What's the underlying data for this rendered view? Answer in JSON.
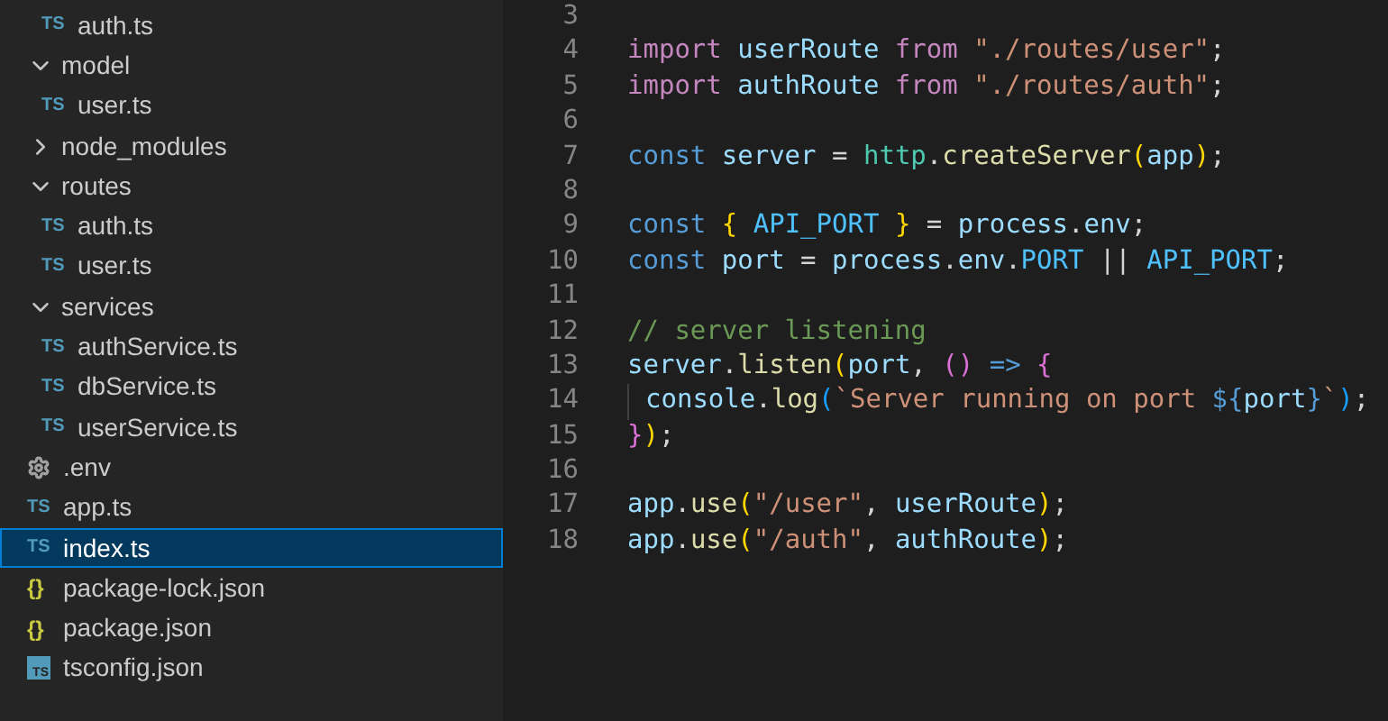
{
  "sidebar": {
    "items": [
      {
        "children": [
          {
            "label": "auth.ts",
            "kind": "ts",
            "badge": "TS",
            "selected": false
          }
        ]
      },
      {
        "label": "model",
        "kind": "folder",
        "expanded": true,
        "selected": false,
        "children": [
          {
            "label": "user.ts",
            "kind": "ts",
            "badge": "TS",
            "selected": false
          }
        ]
      },
      {
        "label": "node_modules",
        "kind": "folder",
        "expanded": false,
        "selected": false
      },
      {
        "label": "routes",
        "kind": "folder",
        "expanded": true,
        "selected": false,
        "children": [
          {
            "label": "auth.ts",
            "kind": "ts",
            "badge": "TS",
            "selected": false
          },
          {
            "label": "user.ts",
            "kind": "ts",
            "badge": "TS",
            "selected": false
          }
        ]
      },
      {
        "label": "services",
        "kind": "folder",
        "expanded": true,
        "selected": false,
        "children": [
          {
            "label": "authService.ts",
            "kind": "ts",
            "badge": "TS",
            "selected": false
          },
          {
            "label": "dbService.ts",
            "kind": "ts",
            "badge": "TS",
            "selected": false
          },
          {
            "label": "userService.ts",
            "kind": "ts",
            "badge": "TS",
            "selected": false
          }
        ]
      },
      {
        "label": ".env",
        "kind": "env",
        "selected": false
      },
      {
        "label": "app.ts",
        "kind": "ts",
        "badge": "TS",
        "selected": false
      },
      {
        "label": "index.ts",
        "kind": "ts",
        "badge": "TS",
        "selected": true
      },
      {
        "label": "package-lock.json",
        "kind": "json",
        "badge": "{}",
        "selected": false
      },
      {
        "label": "package.json",
        "kind": "json",
        "badge": "{}",
        "selected": false
      },
      {
        "label": "tsconfig.json",
        "kind": "tsconfig",
        "badge": "TS",
        "selected": false
      }
    ]
  },
  "editor": {
    "lines": [
      {
        "number": "3"
      },
      {
        "number": "4",
        "tokens": [
          {
            "text": "import ",
            "color": "#c586c0"
          },
          {
            "text": "userRoute ",
            "color": "#9cdcfe"
          },
          {
            "text": "from ",
            "color": "#c586c0"
          },
          {
            "text": "\"./routes/user\"",
            "color": "#ce9178"
          },
          {
            "text": ";",
            "color": "#d4d4d4"
          }
        ]
      },
      {
        "number": "5",
        "tokens": [
          {
            "text": "import ",
            "color": "#c586c0"
          },
          {
            "text": "authRoute ",
            "color": "#9cdcfe"
          },
          {
            "text": "from ",
            "color": "#c586c0"
          },
          {
            "text": "\"./routes/auth\"",
            "color": "#ce9178"
          },
          {
            "text": ";",
            "color": "#d4d4d4"
          }
        ]
      },
      {
        "number": "6"
      },
      {
        "number": "7",
        "tokens": [
          {
            "text": "const ",
            "color": "#569cd6"
          },
          {
            "text": "server",
            "color": "#9cdcfe"
          },
          {
            "text": " = ",
            "color": "#d4d4d4"
          },
          {
            "text": "http",
            "color": "#4ec9b0"
          },
          {
            "text": ".",
            "color": "#d4d4d4"
          },
          {
            "text": "createServer",
            "color": "#dcdcaa"
          },
          {
            "text": "(",
            "color": "#ffd700"
          },
          {
            "text": "app",
            "color": "#9cdcfe"
          },
          {
            "text": ")",
            "color": "#ffd700"
          },
          {
            "text": ";",
            "color": "#d4d4d4"
          }
        ]
      },
      {
        "number": "8"
      },
      {
        "number": "9",
        "tokens": [
          {
            "text": "const ",
            "color": "#569cd6"
          },
          {
            "text": "{ ",
            "color": "#ffd700"
          },
          {
            "text": "API_PORT ",
            "color": "#4fc1ff"
          },
          {
            "text": "}",
            "color": "#ffd700"
          },
          {
            "text": " = ",
            "color": "#d4d4d4"
          },
          {
            "text": "process",
            "color": "#9cdcfe"
          },
          {
            "text": ".",
            "color": "#d4d4d4"
          },
          {
            "text": "env",
            "color": "#9cdcfe"
          },
          {
            "text": ";",
            "color": "#d4d4d4"
          }
        ]
      },
      {
        "number": "10",
        "tokens": [
          {
            "text": "const ",
            "color": "#569cd6"
          },
          {
            "text": "port",
            "color": "#9cdcfe"
          },
          {
            "text": " = ",
            "color": "#d4d4d4"
          },
          {
            "text": "process",
            "color": "#9cdcfe"
          },
          {
            "text": ".",
            "color": "#d4d4d4"
          },
          {
            "text": "env",
            "color": "#9cdcfe"
          },
          {
            "text": ".",
            "color": "#d4d4d4"
          },
          {
            "text": "PORT",
            "color": "#4fc1ff"
          },
          {
            "text": " || ",
            "color": "#d4d4d4"
          },
          {
            "text": "API_PORT",
            "color": "#4fc1ff"
          },
          {
            "text": ";",
            "color": "#d4d4d4"
          }
        ]
      },
      {
        "number": "11"
      },
      {
        "number": "12",
        "tokens": [
          {
            "text": "// server listening",
            "color": "#6a9955"
          }
        ]
      },
      {
        "number": "13",
        "tokens": [
          {
            "text": "server",
            "color": "#9cdcfe"
          },
          {
            "text": ".",
            "color": "#d4d4d4"
          },
          {
            "text": "listen",
            "color": "#dcdcaa"
          },
          {
            "text": "(",
            "color": "#ffd700"
          },
          {
            "text": "port",
            "color": "#9cdcfe"
          },
          {
            "text": ", ",
            "color": "#d4d4d4"
          },
          {
            "text": "() ",
            "color": "#da70d6"
          },
          {
            "text": "=> ",
            "color": "#569cd6"
          },
          {
            "text": "{",
            "color": "#da70d6"
          }
        ]
      },
      {
        "number": "14",
        "guide": true,
        "tokens": [
          {
            "text": "console",
            "color": "#9cdcfe"
          },
          {
            "text": ".",
            "color": "#d4d4d4"
          },
          {
            "text": "log",
            "color": "#dcdcaa"
          },
          {
            "text": "(",
            "color": "#179fff"
          },
          {
            "text": "`Server running on port ",
            "color": "#ce9178"
          },
          {
            "text": "${",
            "color": "#569cd6"
          },
          {
            "text": "port",
            "color": "#9cdcfe"
          },
          {
            "text": "}",
            "color": "#569cd6"
          },
          {
            "text": "`",
            "color": "#ce9178"
          },
          {
            "text": ")",
            "color": "#179fff"
          },
          {
            "text": ";",
            "color": "#d4d4d4"
          }
        ]
      },
      {
        "number": "15",
        "tokens": [
          {
            "text": "}",
            "color": "#da70d6"
          },
          {
            "text": ")",
            "color": "#ffd700"
          },
          {
            "text": ";",
            "color": "#d4d4d4"
          }
        ]
      },
      {
        "number": "16"
      },
      {
        "number": "17",
        "tokens": [
          {
            "text": "app",
            "color": "#9cdcfe"
          },
          {
            "text": ".",
            "color": "#d4d4d4"
          },
          {
            "text": "use",
            "color": "#dcdcaa"
          },
          {
            "text": "(",
            "color": "#ffd700"
          },
          {
            "text": "\"/user\"",
            "color": "#ce9178"
          },
          {
            "text": ", ",
            "color": "#d4d4d4"
          },
          {
            "text": "userRoute",
            "color": "#9cdcfe"
          },
          {
            "text": ")",
            "color": "#ffd700"
          },
          {
            "text": ";",
            "color": "#d4d4d4"
          }
        ]
      },
      {
        "number": "18",
        "tokens": [
          {
            "text": "app",
            "color": "#9cdcfe"
          },
          {
            "text": ".",
            "color": "#d4d4d4"
          },
          {
            "text": "use",
            "color": "#dcdcaa"
          },
          {
            "text": "(",
            "color": "#ffd700"
          },
          {
            "text": "\"/auth\"",
            "color": "#ce9178"
          },
          {
            "text": ", ",
            "color": "#d4d4d4"
          },
          {
            "text": "authRoute",
            "color": "#9cdcfe"
          },
          {
            "text": ")",
            "color": "#ffd700"
          },
          {
            "text": ";",
            "color": "#d4d4d4"
          }
        ]
      }
    ]
  }
}
